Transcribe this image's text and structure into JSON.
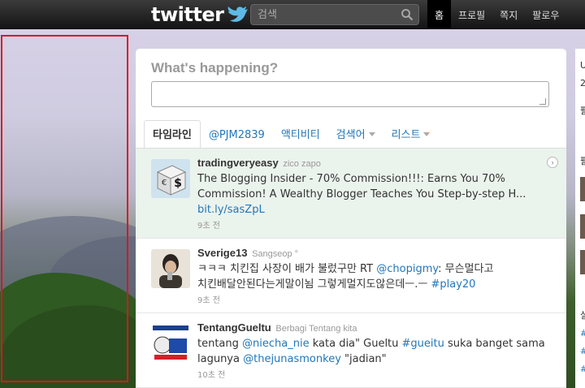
{
  "topbar": {
    "logo_text": "twitter",
    "search_placeholder": "검색",
    "nav": [
      "홈",
      "프로필",
      "쪽지",
      "팔로우"
    ]
  },
  "compose": {
    "label": "What's happening?"
  },
  "tabs": [
    {
      "label": "타임라인",
      "active": true
    },
    {
      "label": "@PJM2839"
    },
    {
      "label": "액티비티"
    },
    {
      "label": "검색어",
      "dropdown": true
    },
    {
      "label": "리스트",
      "dropdown": true
    }
  ],
  "tweets": [
    {
      "user": "tradingveryeasy",
      "name": "zico zapo",
      "line1": "The Blogging Insider - 70% Commission!!!: Earns You 70%",
      "line2": "Commission! A Wealthy Blogger Teaches You Step-by-step H...",
      "link": "bit.ly/sasZpL",
      "time": "9초 전"
    },
    {
      "user": "Sverige13",
      "name": "Sangseop °",
      "line1_a": "ㅋㅋㅋ 치킨집 사장이 배가 불렀구만 RT ",
      "mention": "@chopigmy",
      "line1_b": ": 무슨멀다고",
      "line2_a": "치킨배달안된다는게말이뇜 그렇게멀지도않은데ㅡ.ㅡ ",
      "hashtag": "#play20",
      "time": "9초 전"
    },
    {
      "user": "TentangGueltu",
      "name": "Berbagi Tentang kita",
      "line1_a": "tentang ",
      "mention1": "@niecha_nie",
      "line1_b": " kata dia\" Gueltu ",
      "hashtag": "#gueitu",
      "line1_c": " suka banget sama",
      "line2_a": "lagunya ",
      "mention2": "@thejunasmonkey",
      "line2_b": " \"jadian\"",
      "time": "10초 전"
    }
  ],
  "sidebar": {
    "letters": [
      "U",
      "2",
      "팔",
      "팔",
      "실",
      "#",
      "#",
      "#"
    ]
  },
  "colors": {
    "link": "#2276bb",
    "highlight_border": "#e0131c",
    "selected_tweet_bg": "#ebf3ed"
  }
}
